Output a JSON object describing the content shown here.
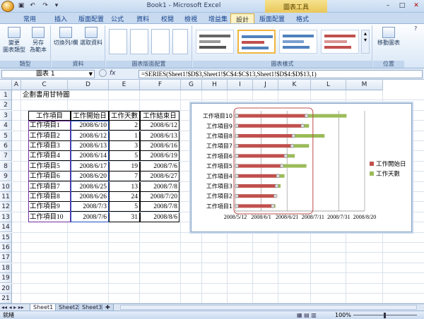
{
  "window": {
    "title": "Book1 - Microsoft Excel",
    "context_tab": "圖表工具"
  },
  "tabs": [
    "常用",
    "插入",
    "版面配置",
    "公式",
    "資料",
    "校閱",
    "檢視",
    "增益集",
    "設計",
    "版面配置",
    "格式"
  ],
  "active_tab": 8,
  "ribbon": {
    "groups": [
      {
        "label": "類型",
        "buttons": [
          "變更\n圖表類型",
          "另存\n為範本"
        ]
      },
      {
        "label": "資料",
        "buttons": [
          "切換列/欄",
          "選取資料"
        ]
      },
      {
        "label": "圖表版面配置",
        "buttons": []
      },
      {
        "label": "圖表樣式",
        "buttons": []
      },
      {
        "label": "位置",
        "buttons": [
          "移動圖表"
        ]
      }
    ]
  },
  "formula_bar": {
    "name_box": "圖表 1",
    "fx_label": "fx",
    "formula": "=SERIES(Sheet1!$D$3,Sheet1!$C$4:$C$13,Sheet1!$D$4:$D$13,1)"
  },
  "columns": [
    "A",
    "C",
    "D",
    "E",
    "F",
    "G",
    "H",
    "I",
    "J",
    "K",
    "L",
    "M"
  ],
  "rows": [
    "1",
    "2",
    "3",
    "4",
    "5",
    "6",
    "7",
    "8",
    "9",
    "10",
    "11",
    "12",
    "13",
    "14",
    "15",
    "16",
    "17",
    "18",
    "19",
    "20",
    "21"
  ],
  "sheet": {
    "title": "企劃書用甘特圖",
    "headers": [
      "工作項目",
      "工作開始日",
      "工作天數",
      "工作結束日"
    ],
    "data": [
      [
        "工作項目1",
        "2008/6/10",
        "2",
        "2008/6/12"
      ],
      [
        "工作項目2",
        "2008/6/12",
        "1",
        "2008/6/13"
      ],
      [
        "工作項目3",
        "2008/6/13",
        "3",
        "2008/6/16"
      ],
      [
        "工作項目4",
        "2008/6/14",
        "5",
        "2008/6/19"
      ],
      [
        "工作項目5",
        "2008/6/17",
        "19",
        "2008/7/6"
      ],
      [
        "工作項目6",
        "2008/6/20",
        "7",
        "2008/6/27"
      ],
      [
        "工作項目7",
        "2008/6/25",
        "13",
        "2008/7/8"
      ],
      [
        "工作項目8",
        "2008/6/26",
        "24",
        "2008/7/20"
      ],
      [
        "工作項目9",
        "2008/7/3",
        "5",
        "2008/7/8"
      ],
      [
        "工作項目10",
        "2008/7/6",
        "31",
        "2008/8/6"
      ]
    ]
  },
  "chart_data": {
    "type": "bar",
    "stacked": true,
    "categories": [
      "工作項目10",
      "工作項目9",
      "工作項目8",
      "工作項目7",
      "工作項目6",
      "工作項目5",
      "工作項目4",
      "工作項目3",
      "工作項目2",
      "工作項目1"
    ],
    "series": [
      {
        "name": "工作開始日",
        "color": "#c0504d",
        "start": [
          "2008/7/6",
          "2008/7/3",
          "2008/6/26",
          "2008/6/25",
          "2008/6/20",
          "2008/6/17",
          "2008/6/14",
          "2008/6/13",
          "2008/6/12",
          "2008/6/10"
        ]
      },
      {
        "name": "工作天數",
        "color": "#9bbb59",
        "values": [
          31,
          5,
          24,
          13,
          7,
          19,
          5,
          3,
          1,
          2
        ]
      }
    ],
    "xaxis": {
      "ticks": [
        "2008/5/12",
        "2008/6/1",
        "2008/6/21",
        "2008/7/11",
        "2008/7/31",
        "2008/8/20"
      ],
      "min": "2008/5/12",
      "max": "2008/8/20"
    },
    "legend": "right",
    "grid": true
  },
  "sheet_tabs": [
    "Sheet1",
    "Sheet2",
    "Sheet3"
  ],
  "status": {
    "left": "就緒",
    "zoom": "100%"
  }
}
